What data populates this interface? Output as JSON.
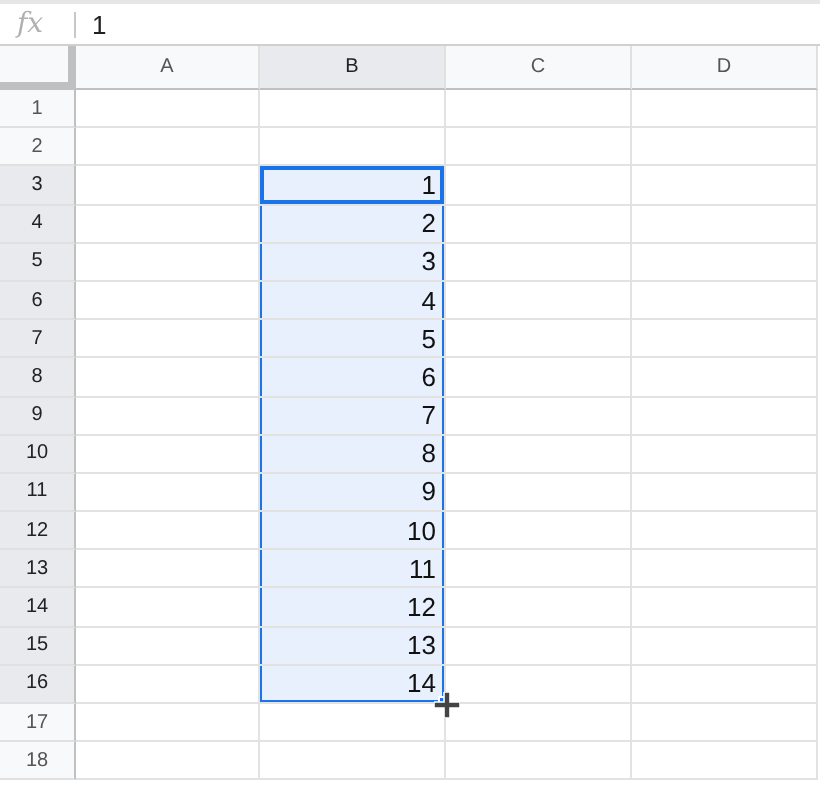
{
  "formula_bar": {
    "label": "fx",
    "value": "1"
  },
  "columns": [
    {
      "label": "A",
      "selected": false
    },
    {
      "label": "B",
      "selected": true
    },
    {
      "label": "C",
      "selected": false
    },
    {
      "label": "D",
      "selected": false
    }
  ],
  "rows": [
    {
      "label": "1",
      "selected": false,
      "cells": [
        {
          "selected": false
        },
        {
          "selected": false
        },
        {
          "selected": false
        },
        {
          "selected": false
        }
      ]
    },
    {
      "label": "2",
      "selected": false,
      "cells": [
        {
          "selected": false
        },
        {
          "selected": false
        },
        {
          "selected": false
        },
        {
          "selected": false
        }
      ]
    },
    {
      "label": "3",
      "selected": true,
      "cells": [
        {
          "selected": false
        },
        {
          "value": "1",
          "selected": true,
          "active": true
        },
        {
          "selected": false
        },
        {
          "selected": false
        }
      ]
    },
    {
      "label": "4",
      "selected": true,
      "cells": [
        {
          "selected": false
        },
        {
          "value": "2",
          "selected": true,
          "active": false
        },
        {
          "selected": false
        },
        {
          "selected": false
        }
      ]
    },
    {
      "label": "5",
      "selected": true,
      "cells": [
        {
          "selected": false
        },
        {
          "value": "3",
          "selected": true,
          "active": false
        },
        {
          "selected": false
        },
        {
          "selected": false
        }
      ]
    },
    {
      "label": "6",
      "selected": true,
      "cells": [
        {
          "selected": false
        },
        {
          "value": "4",
          "selected": true,
          "active": false
        },
        {
          "selected": false
        },
        {
          "selected": false
        }
      ]
    },
    {
      "label": "7",
      "selected": true,
      "cells": [
        {
          "selected": false
        },
        {
          "value": "5",
          "selected": true,
          "active": false
        },
        {
          "selected": false
        },
        {
          "selected": false
        }
      ]
    },
    {
      "label": "8",
      "selected": true,
      "cells": [
        {
          "selected": false
        },
        {
          "value": "6",
          "selected": true,
          "active": false
        },
        {
          "selected": false
        },
        {
          "selected": false
        }
      ]
    },
    {
      "label": "9",
      "selected": true,
      "cells": [
        {
          "selected": false
        },
        {
          "value": "7",
          "selected": true,
          "active": false
        },
        {
          "selected": false
        },
        {
          "selected": false
        }
      ]
    },
    {
      "label": "10",
      "selected": true,
      "cells": [
        {
          "selected": false
        },
        {
          "value": "8",
          "selected": true,
          "active": false
        },
        {
          "selected": false
        },
        {
          "selected": false
        }
      ]
    },
    {
      "label": "11",
      "selected": true,
      "cells": [
        {
          "selected": false
        },
        {
          "value": "9",
          "selected": true,
          "active": false
        },
        {
          "selected": false
        },
        {
          "selected": false
        }
      ]
    },
    {
      "label": "12",
      "selected": true,
      "cells": [
        {
          "selected": false
        },
        {
          "value": "10",
          "selected": true,
          "active": false
        },
        {
          "selected": false
        },
        {
          "selected": false
        }
      ]
    },
    {
      "label": "13",
      "selected": true,
      "cells": [
        {
          "selected": false
        },
        {
          "value": "11",
          "selected": true,
          "active": false
        },
        {
          "selected": false
        },
        {
          "selected": false
        }
      ]
    },
    {
      "label": "14",
      "selected": true,
      "cells": [
        {
          "selected": false
        },
        {
          "value": "12",
          "selected": true,
          "active": false
        },
        {
          "selected": false
        },
        {
          "selected": false
        }
      ]
    },
    {
      "label": "15",
      "selected": true,
      "cells": [
        {
          "selected": false
        },
        {
          "value": "13",
          "selected": true,
          "active": false
        },
        {
          "selected": false
        },
        {
          "selected": false
        }
      ]
    },
    {
      "label": "16",
      "selected": true,
      "cells": [
        {
          "selected": false
        },
        {
          "value": "14",
          "selected": true,
          "active": false
        },
        {
          "selected": false
        },
        {
          "selected": false
        }
      ]
    },
    {
      "label": "17",
      "selected": false,
      "cells": [
        {
          "selected": false
        },
        {
          "selected": false
        },
        {
          "selected": false
        },
        {
          "selected": false
        }
      ]
    },
    {
      "label": "18",
      "selected": false,
      "cells": [
        {
          "selected": false
        },
        {
          "selected": false
        },
        {
          "selected": false
        },
        {
          "selected": false
        }
      ]
    }
  ]
}
